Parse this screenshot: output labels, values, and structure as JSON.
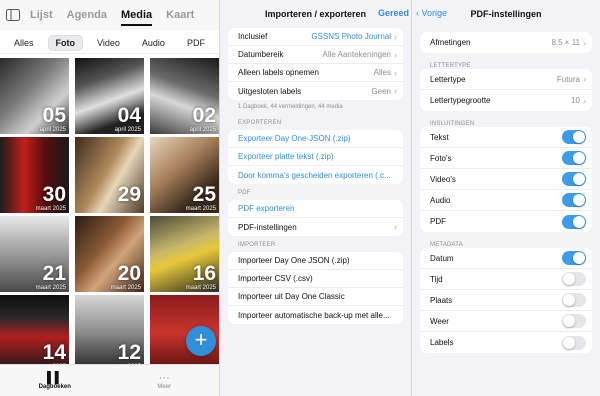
{
  "left": {
    "nav_tabs": [
      "Lijst",
      "Agenda",
      "Media",
      "Kaart"
    ],
    "active_tab": "Media",
    "filters": [
      "Alles",
      "Foto",
      "Video",
      "Audio",
      "PDF"
    ],
    "photos": [
      {
        "day": "05",
        "month": "april 2025",
        "bg": "linear-gradient(135deg,#2a2a2a,#777 40%,#cfcfcf 70%,#333)"
      },
      {
        "day": "04",
        "month": "april 2025",
        "bg": "linear-gradient(160deg,#111,#555 30%,#e0e0e0 55%,#222 80%)"
      },
      {
        "day": "02",
        "month": "april 2025",
        "bg": "linear-gradient(200deg,#1a1a1a,#6b6b6b 40%,#d8d8d8 60%,#3a3a3a)"
      },
      {
        "day": "30",
        "month": "maart 2025",
        "bg": "linear-gradient(90deg,#1c1c1c 0%,#c0201c 35%,#5a0d0d 65%,#1a1a1a)"
      },
      {
        "day": "29",
        "month": "",
        "bg": "linear-gradient(120deg,#3b2a1c,#b08a5c 45%,#e8d6b8 60%,#4a3a28)"
      },
      {
        "day": "25",
        "month": "maart 2025",
        "bg": "linear-gradient(140deg,#e7d7bf,#a7805a 40%,#3a2a1c 75%)"
      },
      {
        "day": "21",
        "month": "maart 2025",
        "bg": "linear-gradient(180deg,#e8e8e8,#9a9a9a 50%,#4a4a4a)"
      },
      {
        "day": "20",
        "month": "maart 2025",
        "bg": "linear-gradient(130deg,#2a1c12,#8a5a36 40%,#d2a47a 60%,#3a2418)"
      },
      {
        "day": "16",
        "month": "maart 2025",
        "bg": "linear-gradient(160deg,#4a4a3a,#c9b86a 40%,#e7c73a 55%,#2a2a22)"
      },
      {
        "day": "14",
        "month": "maart 2025",
        "bg": "linear-gradient(180deg,#0d0d0d,#2a2a2a 30%,#b21f1f 55%,#1a1a1a)"
      },
      {
        "day": "12",
        "month": "maart 2025",
        "bg": "linear-gradient(180deg,#d8d8d8,#8a8a8a 50%,#222)"
      },
      {
        "day": "",
        "month": "",
        "bg": "linear-gradient(180deg,#8a1c1c,#c8352c 50%,#5a1010)"
      }
    ],
    "fab_label": "+",
    "bottom_tabs": [
      {
        "icon": "▌▌",
        "label": "Dagboeken"
      },
      {
        "icon": "···",
        "label": "Meer"
      }
    ]
  },
  "mid": {
    "title": "Importeren / exporteren",
    "done": "Gereed",
    "filter_rows": [
      {
        "label": "Inclusief",
        "value": "GSSNS Photo Journal",
        "blue": true
      },
      {
        "label": "Datumbereik",
        "value": "Alle Aantekeningen",
        "blue": false
      },
      {
        "label": "Alleen labels opnemen",
        "value": "Alles",
        "blue": false
      },
      {
        "label": "Uitgesloten labels",
        "value": "Geen",
        "blue": false
      }
    ],
    "filter_footer": "1 Dagboek, 44 vermeldingen, 44 media",
    "export_header": "EXPORTEREN",
    "export_rows": [
      "Exporteer Day One-JSON (.zip)",
      "Exporteer platte tekst (.zip)",
      "Door komma's gescheiden exporteren (.c..."
    ],
    "pdf_header": "PDF",
    "pdf_rows": [
      {
        "label": "PDF exporteren",
        "link": true
      },
      {
        "label": "PDF-instellingen",
        "link": false
      }
    ],
    "import_header": "IMPORTEER",
    "import_rows": [
      "Importeer Day One JSON (.zip)",
      "Importeer CSV (.csv)",
      "Importeer uit Day One Classic",
      "Importeer automatische back-up met alle..."
    ]
  },
  "right": {
    "back": "Vorige",
    "title": "PDF-instellingen",
    "size_label": "Afmetingen",
    "size_value": "8,5 × 11",
    "font_header": "LETTERTYPE",
    "font_label": "Lettertype",
    "font_value": "Futura",
    "font_size_label": "Lettertypegrootte",
    "font_size_value": "10",
    "incl_header": "INSLUITINGEN",
    "incl_rows": [
      {
        "label": "Tekst",
        "on": true
      },
      {
        "label": "Foto's",
        "on": true
      },
      {
        "label": "Video's",
        "on": true
      },
      {
        "label": "Audio",
        "on": true
      },
      {
        "label": "PDF",
        "on": true
      }
    ],
    "meta_header": "METADATA",
    "meta_rows": [
      {
        "label": "Datum",
        "on": true
      },
      {
        "label": "Tijd",
        "on": false
      },
      {
        "label": "Plaats",
        "on": false
      },
      {
        "label": "Weer",
        "on": false
      },
      {
        "label": "Labels",
        "on": false
      }
    ]
  }
}
